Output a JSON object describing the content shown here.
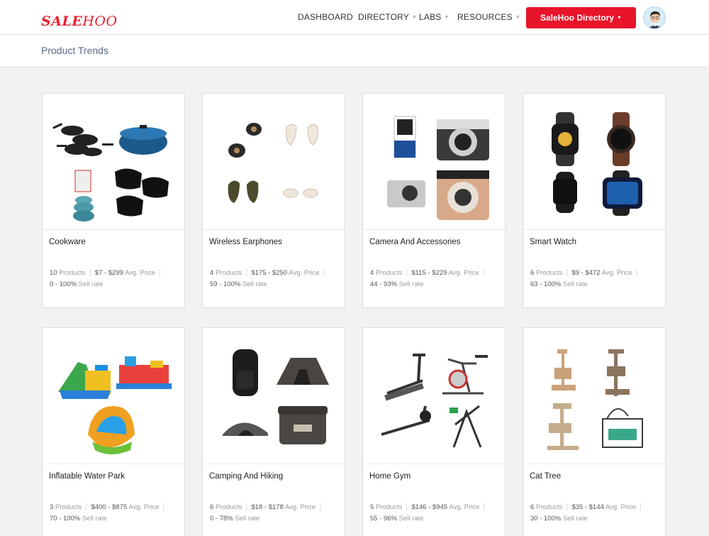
{
  "header": {
    "logo_sale": "SALE",
    "logo_hoo": "HOO",
    "nav": [
      "DASHBOARD",
      "DIRECTORY",
      "LABS",
      "RESOURCES"
    ],
    "cta": "SaleHoo Directory",
    "brand_color": "#e8142a"
  },
  "page": {
    "title": "Product Trends"
  },
  "labels": {
    "products": "Products",
    "avg_price": "Avg. Price",
    "sell_rate": "Sell rate"
  },
  "cards": [
    {
      "title": "Cookware",
      "count": "10",
      "price": "$7 - $299",
      "rate": "0 - 100%"
    },
    {
      "title": "Wireless Earphones",
      "count": "4",
      "price": "$175 - $250",
      "rate": "59 - 100%"
    },
    {
      "title": "Camera And Accessories",
      "count": "4",
      "price": "$115 - $229",
      "rate": "44 - 93%"
    },
    {
      "title": "Smart Watch",
      "count": "6",
      "price": "$9 - $472",
      "rate": "63 - 100%"
    },
    {
      "title": "Inflatable Water Park",
      "count": "3",
      "price": "$400 - $875",
      "rate": "70 - 100%"
    },
    {
      "title": "Camping And Hiking",
      "count": "6",
      "price": "$18 - $178",
      "rate": "0 - 78%"
    },
    {
      "title": "Home Gym",
      "count": "5",
      "price": "$146 - $945",
      "rate": "55 - 96%"
    },
    {
      "title": "Cat Tree",
      "count": "6",
      "price": "$35 - $144",
      "rate": "30 - 100%"
    }
  ]
}
